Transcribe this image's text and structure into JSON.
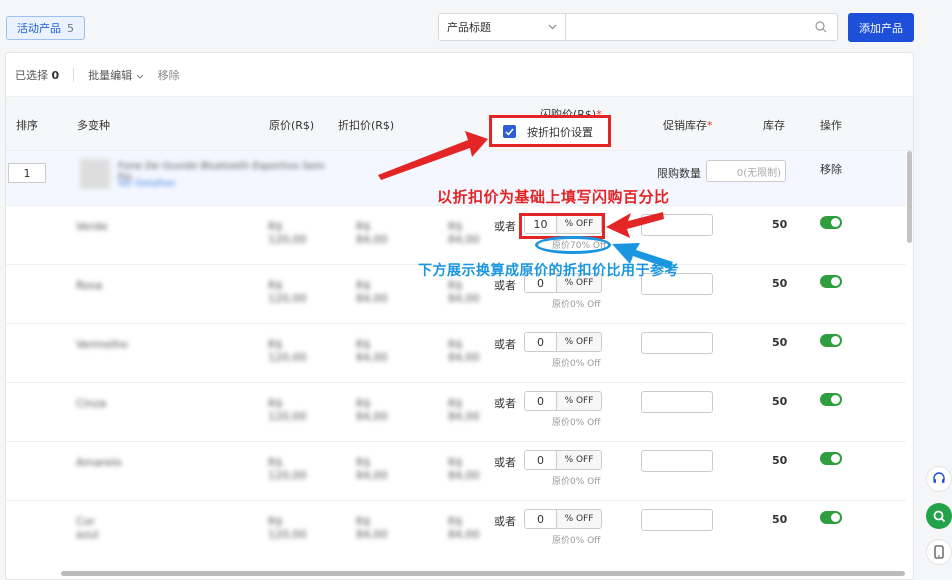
{
  "tabs": {
    "active_label": "活动产品",
    "active_count": "5"
  },
  "search": {
    "field_select": "产品标题",
    "placeholder": ""
  },
  "buttons": {
    "add_product": "添加产品"
  },
  "toolbar": {
    "selected_label": "已选择",
    "selected_count": "0",
    "bulk_edit": "批量编辑",
    "remove": "移除"
  },
  "table": {
    "headers": {
      "sort": "排序",
      "variants": "多变种",
      "orig_price": "原价(R$)",
      "disc_price": "折扣价(R$)",
      "flash_price": "闪购价(R$)",
      "promo_stock": "促销库存",
      "stock": "库存",
      "action": "操作"
    },
    "discount_checkbox_label": "按折扣价设置",
    "product": {
      "sort_value": "1",
      "title": "Fone De Ouvido Bluetooth Esportivo Sem Fio",
      "link": "Ver Detalhes",
      "limit_label": "限购数量",
      "limit_placeholder": "0(无限制)",
      "remove_label": "移除"
    },
    "or_label": "或者",
    "pct_suffix": "% OFF",
    "rows": [
      {
        "variant": "Verde",
        "orig": "R$ 120,00",
        "disc": "R$ 84,00",
        "flash": "R$ 84,00",
        "pct": "10",
        "ref": "原价70% Off",
        "stock": "50"
      },
      {
        "variant": "Rosa",
        "orig": "R$ 120,00",
        "disc": "R$ 84,00",
        "flash": "R$ 84,00",
        "pct": "0",
        "ref": "原价0% Off",
        "stock": "50"
      },
      {
        "variant": "Vermelho",
        "orig": "R$ 120,00",
        "disc": "R$ 84,00",
        "flash": "R$ 84,00",
        "pct": "0",
        "ref": "原价0% Off",
        "stock": "50"
      },
      {
        "variant": "Cinza",
        "orig": "R$ 120,00",
        "disc": "R$ 84,00",
        "flash": "R$ 84,00",
        "pct": "0",
        "ref": "原价0% Off",
        "stock": "50"
      },
      {
        "variant": "Amarelo",
        "orig": "R$ 120,00",
        "disc": "R$ 84,00",
        "flash": "R$ 84,00",
        "pct": "0",
        "ref": "原价0% Off",
        "stock": "50"
      },
      {
        "variant": "Cor azul",
        "orig": "R$ 120,00",
        "disc": "R$ 84,00",
        "flash": "R$ 84,00",
        "pct": "0",
        "ref": "原价0% Off",
        "stock": "50"
      }
    ]
  },
  "annotations": {
    "red_text": "以折扣价为基础上填写闪购百分比",
    "blue_text": "下方展示换算成原价的折扣价比用于参考"
  },
  "colors": {
    "primary": "#1d4fd8",
    "annotation_red": "#e42525",
    "annotation_blue": "#1a96e0",
    "toggle_on": "#2e9e3e"
  }
}
